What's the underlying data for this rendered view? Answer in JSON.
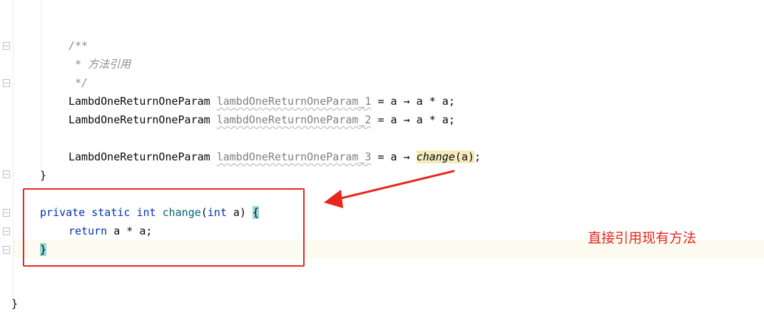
{
  "editor": {
    "comment": {
      "open": "/**",
      "body": " * 方法引用",
      "close": " */"
    },
    "decl_1": {
      "type": "LambdOneReturnOneParam",
      "var": "lambdOneReturnOneParam_1",
      "expr": " = a → a * a;"
    },
    "decl_2": {
      "type": "LambdOneReturnOneParam",
      "var": "lambdOneReturnOneParam_2",
      "expr": " = a → a * a;"
    },
    "decl_3": {
      "type": "LambdOneReturnOneParam",
      "var": "lambdOneReturnOneParam_3",
      "expr_pre": " = a → ",
      "call": "change",
      "args": "(a)",
      "end": ";"
    },
    "close_main": "}",
    "method_sig": {
      "private": "private",
      "static": "static",
      "int": "int",
      "name": "change",
      "lparen": "(",
      "param_type": "int",
      "param_rest": " a) ",
      "brace": "{"
    },
    "return_line": {
      "kw": "return",
      "expr": " a * a;"
    },
    "method_close": "}",
    "class_close": "}"
  },
  "annotation": {
    "text": "直接引用现有方法",
    "color": "#e8261d"
  }
}
